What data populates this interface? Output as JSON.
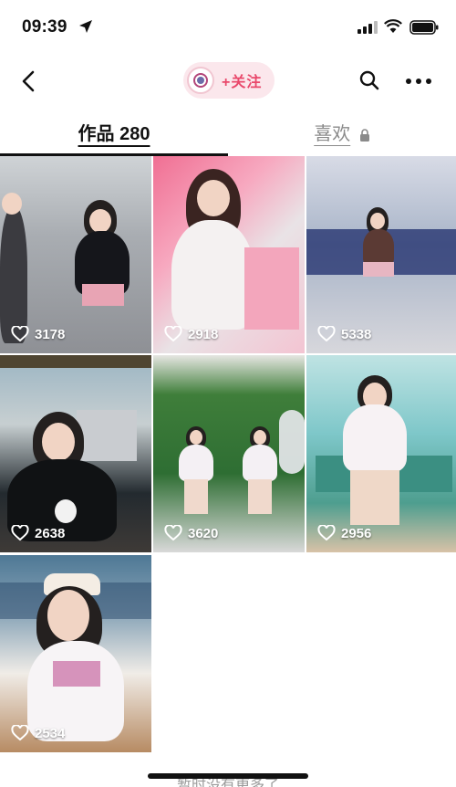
{
  "status": {
    "time": "09:39",
    "icons": [
      "location-arrow-icon",
      "signal-icon",
      "wifi-icon",
      "battery-icon"
    ]
  },
  "nav": {
    "back_icon": "chevron-left-icon",
    "follow_label": "+关注",
    "search_icon": "search-icon",
    "more_icon": "ellipsis-icon"
  },
  "tabs": {
    "works_label": "作品 280",
    "likes_label": "喜欢",
    "likes_icon": "lock-icon"
  },
  "videos": [
    {
      "likes": "3178"
    },
    {
      "likes": "2918"
    },
    {
      "likes": "5338"
    },
    {
      "likes": "2638"
    },
    {
      "likes": "3620"
    },
    {
      "likes": "2956"
    },
    {
      "likes": "2534"
    }
  ],
  "footer": {
    "text": "暂时没有更多了"
  },
  "colors": {
    "follow_text": "#e9486b",
    "follow_bg": "#fbe7ec",
    "inactive_tab": "#8a8a8a"
  }
}
